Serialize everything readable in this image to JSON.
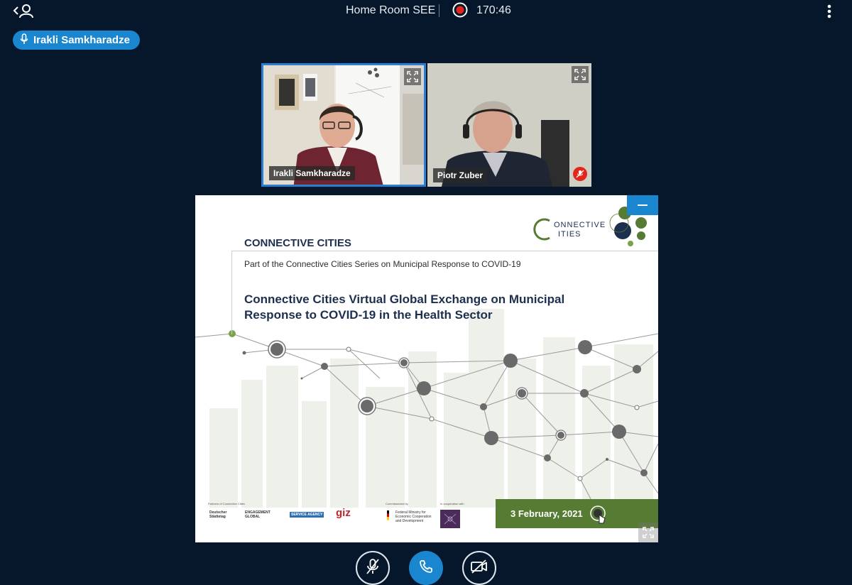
{
  "topbar": {
    "room_title": "Home Room SEE",
    "recording_time": "170:46",
    "icons": {
      "users": "users-toggle-icon",
      "record": "recording-icon",
      "options": "more-options-icon"
    },
    "colors": {
      "record": "#e1261c"
    }
  },
  "talker": {
    "name": "Irakli Samkharadze",
    "icon": "microphone-icon",
    "color": "#1a86d0"
  },
  "tiles": [
    {
      "name": "Irakli Samkharadze",
      "speaking": true,
      "muted": false,
      "border_color": "#2a7fd4"
    },
    {
      "name": "Piotr Zuber",
      "speaking": false,
      "muted": true
    }
  ],
  "presentation": {
    "brand": "CONNECTIVE CITIES",
    "series": "Part of the Connective Cities Series on Municipal Response to COVID-19",
    "title": "Connective Cities Virtual Global Exchange on Municipal Response to COVID-19 in the Health Sector",
    "logo_text_line1": "ONNECTIVE",
    "logo_text_line2": "ITIES",
    "date": "3 February, 2021",
    "partners": {
      "label_partners": "Partners of Connective Cities",
      "label_commissioned": "Commissioned by",
      "label_cooperation": "In cooperation with",
      "logo_1": "Deutscher Städtetag",
      "logo_2": "ENGAGEMENT GLOBAL",
      "logo_3": "SERVICE AGENCY",
      "logo_4": "giz",
      "logo_5": "Federal Ministry for Economic Cooperation and Development"
    },
    "colors": {
      "accent_green": "#567c33",
      "navy": "#1c2f4e"
    }
  },
  "controls": {
    "mic": "microphone-muted-icon",
    "leave": "phone-icon",
    "camera": "camera-off-icon",
    "colors": {
      "primary": "#1a86d0"
    }
  }
}
